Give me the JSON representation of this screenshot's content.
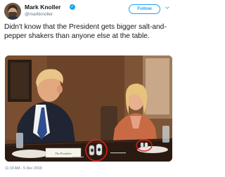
{
  "tweet": {
    "user_name": "Mark Knoller",
    "user_handle": "@markknoller",
    "follow_label": "Follow",
    "text": "Didn't know that the President gets bigger salt-and-pepper shakers than anyone else at the table.",
    "timestamp": "11:19 AM - 5 Dec 2019"
  },
  "photo": {
    "place_card_text": "The President"
  },
  "colors": {
    "accent": "#1da1f2",
    "highlight_circle": "#d81e1e",
    "text_primary": "#14171a",
    "text_secondary": "#657786"
  },
  "icons": {
    "verified": "verified-badge-icon",
    "menu": "chevron-down-icon"
  }
}
